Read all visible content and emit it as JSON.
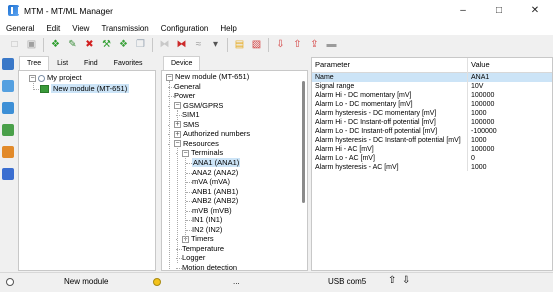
{
  "window": {
    "title": "MTM - MT/ML Manager",
    "minimize_glyph": "–",
    "maximize_glyph": "□",
    "close_glyph": "✕"
  },
  "menu": [
    "General",
    "Edit",
    "View",
    "Transmission",
    "Configuration",
    "Help"
  ],
  "toolbar_icons": [
    {
      "name": "new-icon",
      "glyph": "□",
      "color": "#b0b0b0"
    },
    {
      "name": "save-icon",
      "glyph": "▣",
      "color": "#a0a0a0"
    },
    "sep",
    {
      "name": "add-device-icon",
      "glyph": "❖",
      "color": "#2e9e2e"
    },
    {
      "name": "edit-device-icon",
      "glyph": "✎",
      "color": "#3c8e3c"
    },
    {
      "name": "delete-icon",
      "glyph": "✖",
      "color": "#d22020"
    },
    {
      "name": "tools-icon",
      "glyph": "⚒",
      "color": "#2e9e2e"
    },
    {
      "name": "group-icon",
      "glyph": "❖",
      "color": "#3fa33f"
    },
    {
      "name": "copy-icon",
      "glyph": "❐",
      "color": "#9aa7b5"
    },
    "sep",
    {
      "name": "connect-icon",
      "glyph": "⧓",
      "color": "#c9c9c9"
    },
    {
      "name": "disconnect-icon",
      "glyph": "⧓",
      "color": "#cc2a2a"
    },
    {
      "name": "signal-icon",
      "glyph": "≈",
      "color": "#9b9b9b"
    },
    {
      "name": "dropdown-arrow-icon",
      "glyph": "▾",
      "color": "#555555"
    },
    "sep",
    {
      "name": "folder-icon",
      "glyph": "▤",
      "color": "#e6a91a"
    },
    {
      "name": "transfer-icon",
      "glyph": "▧",
      "color": "#d33a3a"
    },
    "sep",
    {
      "name": "download-icon",
      "glyph": "⇩",
      "color": "#d33a3a"
    },
    {
      "name": "upload-icon",
      "glyph": "⇧",
      "color": "#d33a3a"
    },
    {
      "name": "upload-alt-icon",
      "glyph": "⇪",
      "color": "#d33a3a"
    },
    {
      "name": "battery-icon",
      "glyph": "▬",
      "color": "#9b9b9b"
    }
  ],
  "left_sidebar_icons": [
    {
      "name": "config-icon",
      "color": "#3a78c8"
    },
    {
      "name": "network-icon",
      "color": "#55a0e0"
    },
    {
      "name": "monitor-icon",
      "color": "#3d8fd6"
    },
    {
      "name": "gprs-icon",
      "color": "#4aa04a"
    },
    {
      "name": "modules-icon",
      "color": "#e28a2a"
    },
    {
      "name": "apps-icon",
      "color": "#3b6ed0"
    }
  ],
  "project_tabs": [
    {
      "label": "Tree",
      "active": true
    },
    {
      "label": "List",
      "active": false
    },
    {
      "label": "Find",
      "active": false
    },
    {
      "label": "Favorites",
      "active": false
    }
  ],
  "project_tree": {
    "root": "My project",
    "child": "New module (MT-651)",
    "expander": "−"
  },
  "device_tab": "Device",
  "device_tree": [
    {
      "label": "New module (MT-651)",
      "level": 0,
      "exp": "−"
    },
    {
      "label": "General",
      "level": 1
    },
    {
      "label": "Power",
      "level": 1
    },
    {
      "label": "GSM/GPRS",
      "level": 1,
      "exp": "−"
    },
    {
      "label": "SIM1",
      "level": 2
    },
    {
      "label": "SMS",
      "level": 1,
      "exp": "+"
    },
    {
      "label": "Authorized numbers",
      "level": 1,
      "exp": "+"
    },
    {
      "label": "Resources",
      "level": 1,
      "exp": "−"
    },
    {
      "label": "Terminals",
      "level": 2,
      "exp": "−"
    },
    {
      "label": "ANA1 (ANA1)",
      "level": 3,
      "selected": true
    },
    {
      "label": "ANA2 (ANA2)",
      "level": 3
    },
    {
      "label": "mVA (mVA)",
      "level": 3
    },
    {
      "label": "ANB1 (ANB1)",
      "level": 3
    },
    {
      "label": "ANB2 (ANB2)",
      "level": 3
    },
    {
      "label": "mVB (mVB)",
      "level": 3
    },
    {
      "label": "IN1 (IN1)",
      "level": 3
    },
    {
      "label": "IN2 (IN2)",
      "level": 3
    },
    {
      "label": "Timers",
      "level": 2,
      "exp": "+"
    },
    {
      "label": "Temperature",
      "level": 2
    },
    {
      "label": "Logger",
      "level": 2
    },
    {
      "label": "Motion detection",
      "level": 2
    }
  ],
  "params": {
    "header_param": "Parameter",
    "header_value": "Value",
    "rows": [
      {
        "param": "Name",
        "value": "ANA1"
      },
      {
        "param": "Signal range",
        "value": "10V"
      },
      {
        "param": "Alarm Hi - DC momentary [mV]",
        "value": "100000"
      },
      {
        "param": "Alarm Lo - DC momentary [mV]",
        "value": "100000"
      },
      {
        "param": "Alarm hysteresis - DC momentary [mV]",
        "value": "1000"
      },
      {
        "param": "Alarm Hi - DC Instant-off potential [mV]",
        "value": "100000"
      },
      {
        "param": "Alarm Lo - DC Instant-off potential [mV]",
        "value": "-100000"
      },
      {
        "param": "Alarm hysteresis - DC Instant-off potential [mV]",
        "value": "1000"
      },
      {
        "param": "Alarm Hi - AC [mV]",
        "value": "100000"
      },
      {
        "param": "Alarm Lo - AC [mV]",
        "value": "0"
      },
      {
        "param": "Alarm hysteresis - AC [mV]",
        "value": "1000"
      }
    ]
  },
  "status": {
    "module_name": "New module",
    "dots": "...",
    "port": "USB com5",
    "up_arrow": "⇧",
    "down_arrow": "⇩",
    "led1_color": "#ffffff",
    "led2_color": "#f3c21b"
  }
}
